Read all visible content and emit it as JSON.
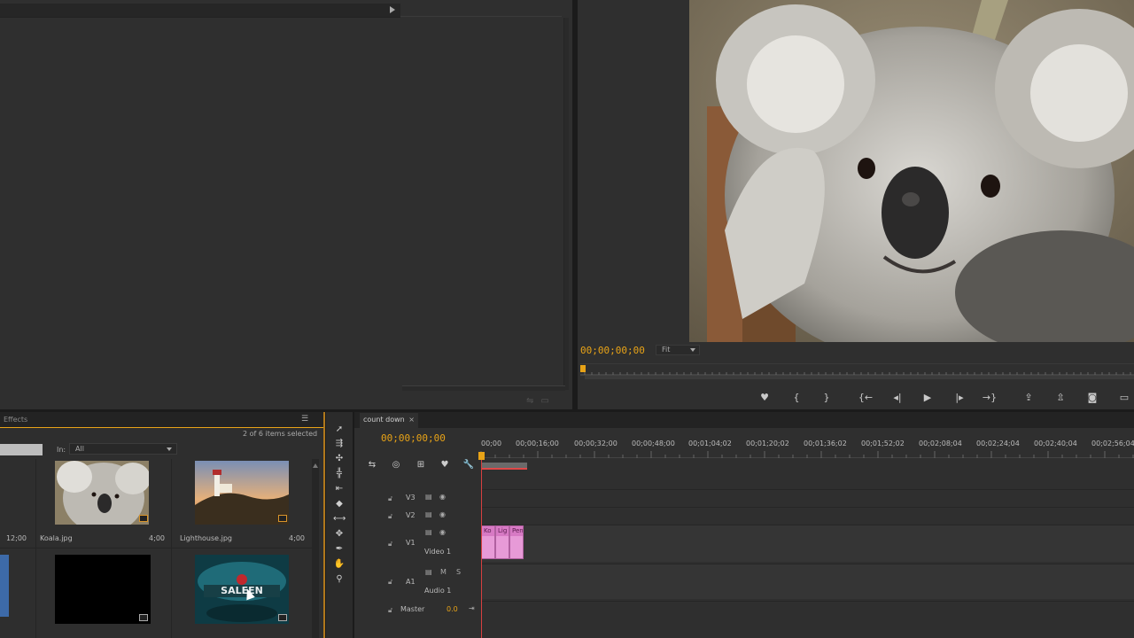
{
  "source": {
    "menu_arrow": "play-right-icon"
  },
  "program": {
    "timecode": "00;00;00;00",
    "zoom": "Fit",
    "controls": [
      {
        "name": "add-marker-button",
        "glyph": "♥"
      },
      {
        "name": "mark-in-button",
        "glyph": "{"
      },
      {
        "name": "mark-out-button",
        "glyph": "}"
      },
      {
        "name": "go-to-in-button",
        "glyph": "{←"
      },
      {
        "name": "step-back-button",
        "glyph": "◂|"
      },
      {
        "name": "play-button",
        "glyph": "▶"
      },
      {
        "name": "step-forward-button",
        "glyph": "|▸"
      },
      {
        "name": "go-to-out-button",
        "glyph": "→}"
      },
      {
        "name": "lift-button",
        "glyph": "⇪"
      },
      {
        "name": "extract-button",
        "glyph": "⇫"
      },
      {
        "name": "export-frame-button",
        "glyph": "◙"
      },
      {
        "name": "button-editor-button",
        "glyph": "▭"
      }
    ]
  },
  "project": {
    "tab_label": "Effects",
    "items_selected": "2 of 6 items selected",
    "in_label": "In:",
    "in_value": "All",
    "items": [
      {
        "name": "",
        "duration": "12;00"
      },
      {
        "name": "Koala.jpg",
        "duration": "4;00"
      },
      {
        "name": "Lighthouse.jpg",
        "duration": "4;00"
      }
    ]
  },
  "timeline": {
    "tab_label": "count down",
    "close_glyph": "×",
    "timecode": "00;00;00;00",
    "ruler": [
      "00;00",
      "00;00;16;00",
      "00;00;32;00",
      "00;00;48;00",
      "00;01;04;02",
      "00;01;20;02",
      "00;01;36;02",
      "00;01;52;02",
      "00;02;08;04",
      "00;02;24;04",
      "00;02;40;04",
      "00;02;56;04"
    ],
    "tracks": {
      "v3": "V3",
      "v2": "V2",
      "v1": "V1",
      "video1": "Video 1",
      "a1": "A1",
      "audio1": "Audio 1",
      "master": "Master",
      "master_value": "0.0",
      "m_label": "M",
      "s_label": "S"
    },
    "clips": [
      "Ko",
      "Lig",
      "Pen"
    ]
  },
  "tools": [
    "selection-tool-icon",
    "track-select-tool-icon",
    "ripple-edit-tool-icon",
    "rolling-edit-tool-icon",
    "rate-stretch-tool-icon",
    "razor-tool-icon",
    "slip-tool-icon",
    "slide-tool-icon",
    "pen-tool-icon",
    "hand-tool-icon",
    "zoom-tool-icon"
  ]
}
